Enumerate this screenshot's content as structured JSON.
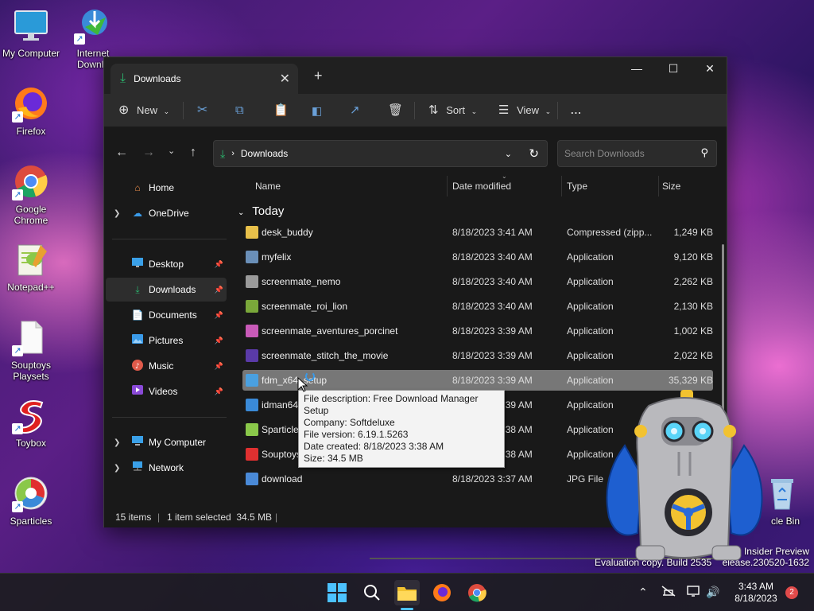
{
  "desktop": {
    "icons": [
      {
        "label": "My Computer",
        "icon": "monitor-icon"
      },
      {
        "label": "Internet Downlo",
        "icon": "internet-download-manager-icon"
      },
      {
        "label": "Firefox",
        "icon": "firefox-icon"
      },
      {
        "label": "Google Chrome",
        "icon": "chrome-icon"
      },
      {
        "label": "Notepad++",
        "icon": "notepad-plus-plus-icon"
      },
      {
        "label": "Souptoys Playsets",
        "icon": "blank-file-icon"
      },
      {
        "label": "Toybox",
        "icon": "souptoys-s-icon"
      },
      {
        "label": "Sparticles",
        "icon": "sparticles-icon"
      },
      {
        "label": "cle Bin",
        "icon": "recycle-bin-icon"
      }
    ]
  },
  "window": {
    "tab_title": "Downloads",
    "toolbar": {
      "new_label": "New",
      "sort_label": "Sort",
      "view_label": "View",
      "more_label": "..."
    },
    "address": {
      "location": "Downloads"
    },
    "search": {
      "placeholder": "Search Downloads"
    },
    "nav_pane": {
      "items": [
        {
          "label": "Home",
          "icon": "home-icon"
        },
        {
          "label": "OneDrive",
          "icon": "cloud-icon"
        },
        {
          "label": "Desktop",
          "icon": "desktop-folder-icon"
        },
        {
          "label": "Downloads",
          "icon": "download-icon"
        },
        {
          "label": "Documents",
          "icon": "documents-icon"
        },
        {
          "label": "Pictures",
          "icon": "pictures-icon"
        },
        {
          "label": "Music",
          "icon": "music-icon"
        },
        {
          "label": "Videos",
          "icon": "videos-icon"
        },
        {
          "label": "My Computer",
          "icon": "computer-icon"
        },
        {
          "label": "Network",
          "icon": "network-icon"
        }
      ]
    },
    "columns": {
      "name": "Name",
      "date": "Date modified",
      "type": "Type",
      "size": "Size"
    },
    "group_label": "Today",
    "files": [
      {
        "name": "desk_buddy",
        "date": "8/18/2023 3:41 AM",
        "type": "Compressed (zipp...",
        "size": "1,249 KB",
        "color": "#e8c04a"
      },
      {
        "name": "myfelix",
        "date": "8/18/2023 3:40 AM",
        "type": "Application",
        "size": "9,120 KB",
        "color": "#6a8fb8"
      },
      {
        "name": "screenmate_nemo",
        "date": "8/18/2023 3:40 AM",
        "type": "Application",
        "size": "2,262 KB",
        "color": "#9a9a9a"
      },
      {
        "name": "screenmate_roi_lion",
        "date": "8/18/2023 3:40 AM",
        "type": "Application",
        "size": "2,130 KB",
        "color": "#7aa83a"
      },
      {
        "name": "screenmate_aventures_porcinet",
        "date": "8/18/2023 3:39 AM",
        "type": "Application",
        "size": "1,002 KB",
        "color": "#c85ab8"
      },
      {
        "name": "screenmate_stitch_the_movie",
        "date": "8/18/2023 3:39 AM",
        "type": "Application",
        "size": "2,022 KB",
        "color": "#5a3aa8"
      },
      {
        "name": "fdm_x64_setup",
        "date": "8/18/2023 3:39 AM",
        "type": "Application",
        "size": "35,329 KB",
        "color": "#4aa0e0"
      },
      {
        "name": "idman64",
        "date": "8/18/2023 3:39 AM",
        "type": "Application",
        "size": "",
        "color": "#3a8ad8"
      },
      {
        "name": "Sparticles",
        "date": "8/18/2023 3:38 AM",
        "type": "Application",
        "size": "",
        "color": "#8ac84a"
      },
      {
        "name": "Souptoys1.0.0.8",
        "date": "8/18/2023 3:38 AM",
        "type": "Application",
        "size": "",
        "color": "#e03030"
      },
      {
        "name": "download",
        "date": "8/18/2023 3:37 AM",
        "type": "JPG File",
        "size": "",
        "color": "#4a8ad8"
      }
    ],
    "status": {
      "items": "15 items",
      "selection": "1 item selected  34.5 MB"
    }
  },
  "tooltip": {
    "lines": [
      "File description: Free Download Manager Setup",
      "Company: Softdeluxe",
      "File version: 6.19.1.5263",
      "Date created: 8/18/2023 3:38 AM",
      "Size: 34.5 MB"
    ]
  },
  "watermark": {
    "line1": "Windo        Insider Preview",
    "line2": "Evaluation copy. Build 2535    elease.230520-1632"
  },
  "taskbar": {
    "apps": [
      "start-icon",
      "search-icon",
      "file-explorer-icon",
      "firefox-icon",
      "chrome-icon"
    ],
    "time": "3:43 AM",
    "date": "8/18/2023",
    "notification_count": "2"
  }
}
